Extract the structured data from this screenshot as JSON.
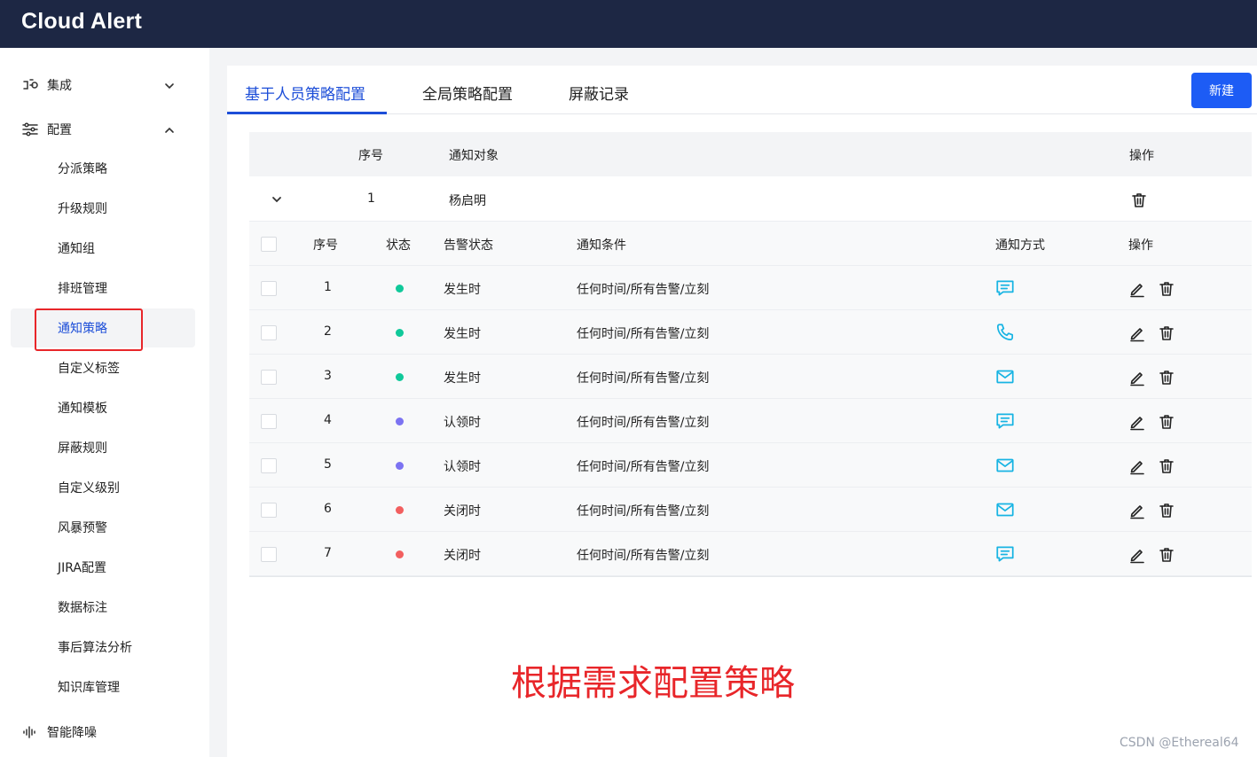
{
  "app": {
    "title": "Cloud Alert"
  },
  "sidebar": {
    "groups": [
      {
        "label": "集成",
        "icon": "integration-icon",
        "expanded": false
      },
      {
        "label": "配置",
        "icon": "sliders-icon",
        "expanded": true
      },
      {
        "label": "智能降噪",
        "icon": "waveform-icon"
      }
    ],
    "items": [
      {
        "label": "分派策略"
      },
      {
        "label": "升级规则"
      },
      {
        "label": "通知组"
      },
      {
        "label": "排班管理"
      },
      {
        "label": "通知策略",
        "active": true
      },
      {
        "label": "自定义标签"
      },
      {
        "label": "通知模板"
      },
      {
        "label": "屏蔽规则"
      },
      {
        "label": "自定义级别"
      },
      {
        "label": "风暴预警"
      },
      {
        "label": "JIRA配置"
      },
      {
        "label": "数据标注"
      },
      {
        "label": "事后算法分析"
      },
      {
        "label": "知识库管理"
      }
    ]
  },
  "tabs": [
    {
      "label": "基于人员策略配置",
      "active": true
    },
    {
      "label": "全局策略配置"
    },
    {
      "label": "屏蔽记录"
    }
  ],
  "toolbar": {
    "new_label": "新建"
  },
  "outer_table": {
    "headers": {
      "seq": "序号",
      "target": "通知对象",
      "action": "操作"
    },
    "row": {
      "seq": "1",
      "target": "杨启明"
    }
  },
  "inner_table": {
    "headers": {
      "seq": "序号",
      "status": "状态",
      "alert_status": "告警状态",
      "condition": "通知条件",
      "method": "通知方式",
      "action": "操作"
    },
    "rows": [
      {
        "seq": "1",
        "status_color": "#10c99a",
        "alert_status": "发生时",
        "condition": "任何时间/所有告警/立刻",
        "method": "sms-icon"
      },
      {
        "seq": "2",
        "status_color": "#10c99a",
        "alert_status": "发生时",
        "condition": "任何时间/所有告警/立刻",
        "method": "phone-icon"
      },
      {
        "seq": "3",
        "status_color": "#10c99a",
        "alert_status": "发生时",
        "condition": "任何时间/所有告警/立刻",
        "method": "email-icon"
      },
      {
        "seq": "4",
        "status_color": "#7c73f2",
        "alert_status": "认领时",
        "condition": "任何时间/所有告警/立刻",
        "method": "sms-icon"
      },
      {
        "seq": "5",
        "status_color": "#7c73f2",
        "alert_status": "认领时",
        "condition": "任何时间/所有告警/立刻",
        "method": "email-icon"
      },
      {
        "seq": "6",
        "status_color": "#f25f5f",
        "alert_status": "关闭时",
        "condition": "任何时间/所有告警/立刻",
        "method": "email-icon"
      },
      {
        "seq": "7",
        "status_color": "#f25f5f",
        "alert_status": "关闭时",
        "condition": "任何时间/所有告警/立刻",
        "method": "sms-icon"
      }
    ]
  },
  "annotation": "根据需求配置策略",
  "watermark": "CSDN @Ethereal64",
  "colors": {
    "accent": "#1d4ed8",
    "topbar": "#1d2744",
    "method_icon": "#18b4e3",
    "highlight": "#e8262a"
  }
}
